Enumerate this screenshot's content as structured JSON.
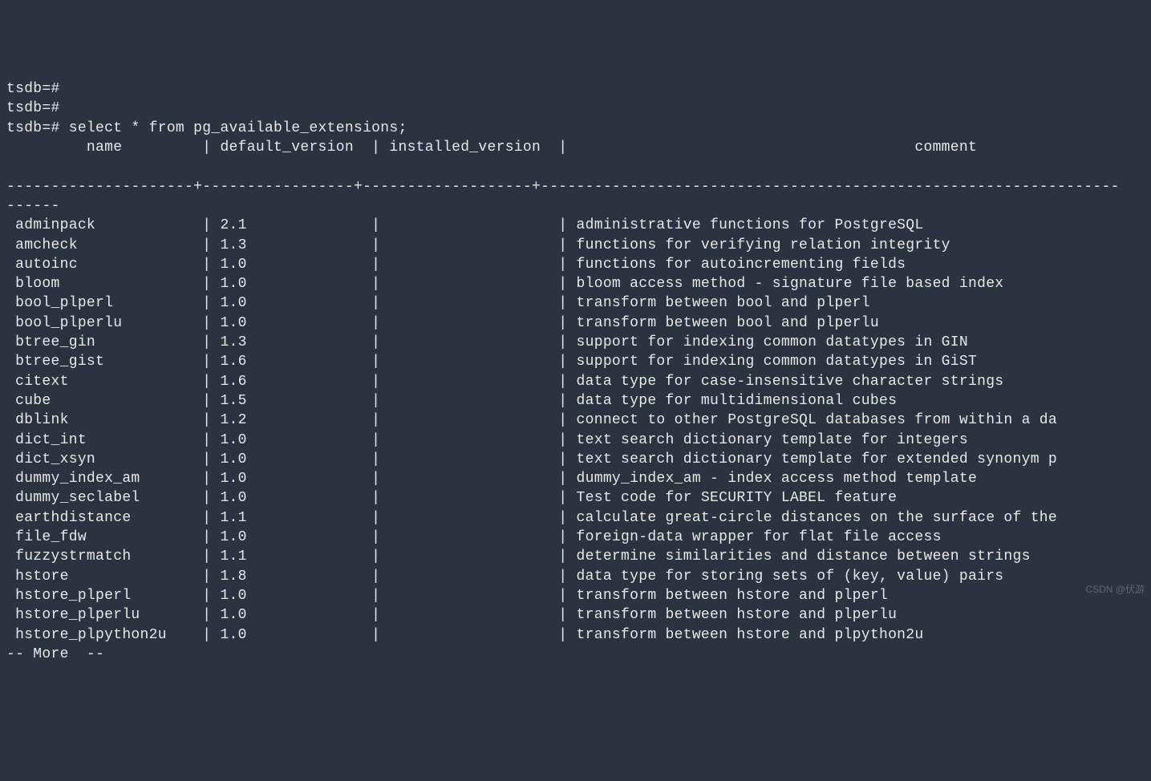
{
  "prompts": [
    "tsdb=#",
    "tsdb=#",
    "tsdb=# select * from pg_available_extensions;"
  ],
  "columns": {
    "name": "name",
    "default_version": "default_version",
    "installed_version": "installed_version",
    "comment": "comment"
  },
  "separator_line": "---------------------+-----------------+-------------------+-----------------------------------------------------------------",
  "separator_cont": "------",
  "chart_data": {
    "type": "table",
    "columns": [
      "name",
      "default_version",
      "installed_version",
      "comment"
    ],
    "rows": [
      {
        "name": "adminpack",
        "default_version": "2.1",
        "installed_version": "",
        "comment": "administrative functions for PostgreSQL"
      },
      {
        "name": "amcheck",
        "default_version": "1.3",
        "installed_version": "",
        "comment": "functions for verifying relation integrity"
      },
      {
        "name": "autoinc",
        "default_version": "1.0",
        "installed_version": "",
        "comment": "functions for autoincrementing fields"
      },
      {
        "name": "bloom",
        "default_version": "1.0",
        "installed_version": "",
        "comment": "bloom access method - signature file based index"
      },
      {
        "name": "bool_plperl",
        "default_version": "1.0",
        "installed_version": "",
        "comment": "transform between bool and plperl"
      },
      {
        "name": "bool_plperlu",
        "default_version": "1.0",
        "installed_version": "",
        "comment": "transform between bool and plperlu"
      },
      {
        "name": "btree_gin",
        "default_version": "1.3",
        "installed_version": "",
        "comment": "support for indexing common datatypes in GIN"
      },
      {
        "name": "btree_gist",
        "default_version": "1.6",
        "installed_version": "",
        "comment": "support for indexing common datatypes in GiST"
      },
      {
        "name": "citext",
        "default_version": "1.6",
        "installed_version": "",
        "comment": "data type for case-insensitive character strings"
      },
      {
        "name": "cube",
        "default_version": "1.5",
        "installed_version": "",
        "comment": "data type for multidimensional cubes"
      },
      {
        "name": "dblink",
        "default_version": "1.2",
        "installed_version": "",
        "comment": "connect to other PostgreSQL databases from within a da"
      },
      {
        "name": "dict_int",
        "default_version": "1.0",
        "installed_version": "",
        "comment": "text search dictionary template for integers"
      },
      {
        "name": "dict_xsyn",
        "default_version": "1.0",
        "installed_version": "",
        "comment": "text search dictionary template for extended synonym p"
      },
      {
        "name": "dummy_index_am",
        "default_version": "1.0",
        "installed_version": "",
        "comment": "dummy_index_am - index access method template"
      },
      {
        "name": "dummy_seclabel",
        "default_version": "1.0",
        "installed_version": "",
        "comment": "Test code for SECURITY LABEL feature"
      },
      {
        "name": "earthdistance",
        "default_version": "1.1",
        "installed_version": "",
        "comment": "calculate great-circle distances on the surface of the"
      },
      {
        "name": "file_fdw",
        "default_version": "1.0",
        "installed_version": "",
        "comment": "foreign-data wrapper for flat file access"
      },
      {
        "name": "fuzzystrmatch",
        "default_version": "1.1",
        "installed_version": "",
        "comment": "determine similarities and distance between strings"
      },
      {
        "name": "hstore",
        "default_version": "1.8",
        "installed_version": "",
        "comment": "data type for storing sets of (key, value) pairs"
      },
      {
        "name": "hstore_plperl",
        "default_version": "1.0",
        "installed_version": "",
        "comment": "transform between hstore and plperl"
      },
      {
        "name": "hstore_plperlu",
        "default_version": "1.0",
        "installed_version": "",
        "comment": "transform between hstore and plperlu"
      },
      {
        "name": "hstore_plpython2u",
        "default_version": "1.0",
        "installed_version": "",
        "comment": "transform between hstore and plpython2u"
      }
    ]
  },
  "pager": "-- More  --",
  "watermark": "CSDN @伏游",
  "widths": {
    "name": 20,
    "default_version": 16,
    "installed_version": 18
  }
}
